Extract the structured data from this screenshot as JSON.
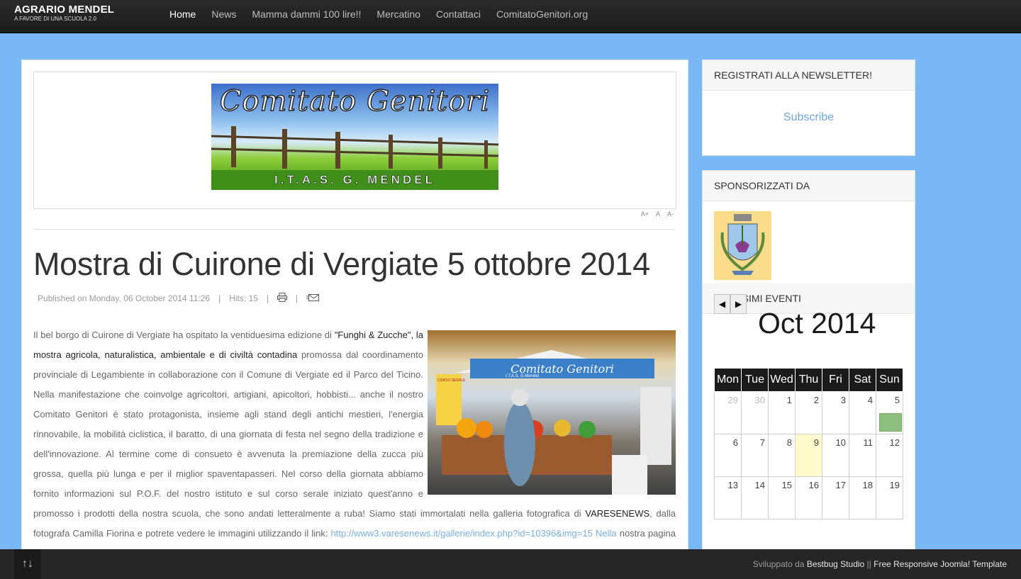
{
  "header": {
    "brand_title": "AGRARIO MENDEL",
    "brand_tagline": "A FAVORE DI UNA SCUOLA 2.0",
    "nav": [
      {
        "label": "Home",
        "active": true
      },
      {
        "label": "News"
      },
      {
        "label": "Mamma dammi 100 lire!!"
      },
      {
        "label": "Mercatino"
      },
      {
        "label": "Contattaci"
      },
      {
        "label": "ComitatoGenitori.org"
      }
    ]
  },
  "banner": {
    "title": "Comitato Genitori",
    "subtitle": "I.T.A.S. G. MENDEL"
  },
  "font_resize": {
    "increase": "A+",
    "reset": "A",
    "decrease": "A-"
  },
  "article": {
    "title": "Mostra di Cuirone di Vergiate 5 ottobre 2014",
    "published": "Published on Monday, 06 October 2014 11:26",
    "hits": "Hits: 15",
    "print_icon": "printer-icon",
    "email_icon": "email-icon",
    "p1": "Il bel borgo di Cuirone di Vergiate  ha ospitato la ventiduesima edizione di ",
    "p2": "\"Funghi & Zucche\", la mostra agricola, naturalistica, ambientale e di civiltà contadina",
    "p3": " promossa dal coordinamento provinciale di Legambiente in collaborazione con il Comune di Vergiate ed il Parco del Ticino. Nella manifestazione che coinvolge agricoltori, artigiani, apicoltori, hobbisti... anche il nostro Comitato Genitori è stato protagonista, insieme agli stand degli antichi mestieri, l'energia rinnovabile, la mobilità ciclistica, il baratto, di una giornata di festa  nel segno della tradizione e dell'innovazione. Al termine come di consueto è avvenuta la premiazione della zucca più grossa, quella più lunga e per il miglior spaventapasseri. Nel corso della giornata  abbiamo fornito informazioni sul P.O.F. del nostro istituto e sul corso serale iniziato quest'anno e promosso i prodotti della nostra scuola, che sono andati letteralmente a ruba! Siamo stati immortalati nella galleria fotografica di ",
    "p4": "VARESENEWS",
    "p5": ", dalla fotografa  Camilla Fiorina e  potrete vedere le immagini utilizzando il link: ",
    "p6": "http://www3.varesenews.it/gallerie/index.php?id=10396&img=15",
    "p7": "    ",
    "p8": "Nella",
    "p9": " nostra pagina FB troverete altre immagini dei nuovi e \" vecchi \"",
    "photo_stand_label": "Comitato Genitori",
    "photo_stand_sub": "I.T.A.S. G.Mendel",
    "photo_sign": "CORSO SERALE"
  },
  "sidebar": {
    "newsletter": {
      "title": "REGISTRATI ALLA NEWSLETTER!",
      "subscribe": "Subscribe"
    },
    "sponsors": {
      "title": "SPONSORIZZATI DA"
    },
    "events": {
      "title": "PROSSIMI EVENTI",
      "prev": "◀",
      "next": "▶",
      "month": "Oct 2014",
      "weekdays": [
        "Mon",
        "Tue",
        "Wed",
        "Thu",
        "Fri",
        "Sat",
        "Sun"
      ],
      "weeks": [
        [
          "29",
          "30",
          "1",
          "2",
          "3",
          "4",
          "5"
        ],
        [
          "6",
          "7",
          "8",
          "9",
          "10",
          "11",
          "12"
        ],
        [
          "13",
          "14",
          "15",
          "16",
          "17",
          "18",
          "19"
        ]
      ],
      "today": "9",
      "event_day": "5"
    }
  },
  "footer": {
    "toggle_icon": "sort-arrows-icon",
    "toggle_glyph": "↑↓",
    "credit_prefix": "Sviluppato da ",
    "credit_author": "Bestbug Studio",
    "credit_sep": " || ",
    "credit_template": "Free Responsive Joomla! Template"
  }
}
